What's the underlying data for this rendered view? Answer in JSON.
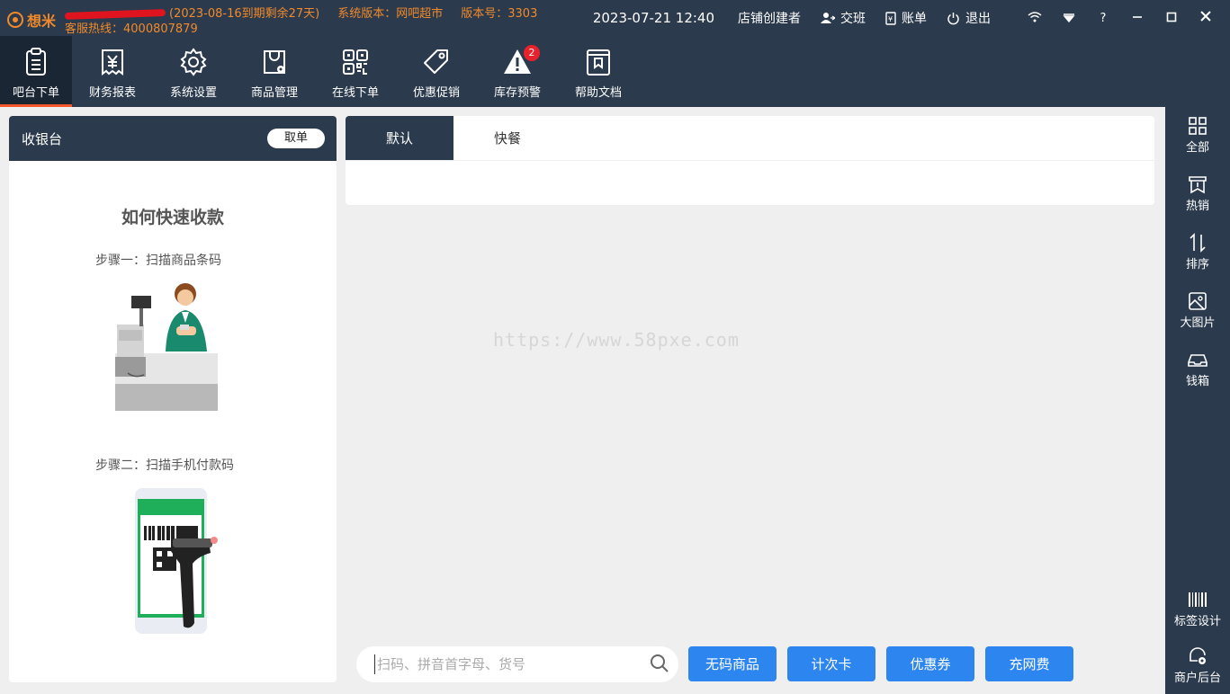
{
  "titlebar": {
    "logo_text": "想米",
    "expiry": "(2023-08-16到期剩余27天)",
    "system_version": "系统版本：网吧超市",
    "version_number": "版本号：3303",
    "hotline": "客服热线：4000807879",
    "datetime": "2023-07-21 12:40",
    "user": "店铺创建者",
    "shift": "交班",
    "bill": "账单",
    "logout": "退出",
    "help": "?"
  },
  "mainnav": [
    {
      "label": "吧台下单",
      "icon": "clipboard-icon"
    },
    {
      "label": "财务报表",
      "icon": "yen-receipt-icon"
    },
    {
      "label": "系统设置",
      "icon": "gear-icon"
    },
    {
      "label": "商品管理",
      "icon": "bag-gear-icon"
    },
    {
      "label": "在线下单",
      "icon": "qrcode-icon"
    },
    {
      "label": "优惠促销",
      "icon": "tag-icon"
    },
    {
      "label": "库存预警",
      "icon": "warning-icon",
      "badge": "2"
    },
    {
      "label": "帮助文档",
      "icon": "book-icon"
    }
  ],
  "cashier": {
    "title": "收银台",
    "cancel": "取单",
    "howto_title": "如何快速收款",
    "step1": "步骤一：扫描商品条码",
    "step2": "步骤二：扫描手机付款码"
  },
  "tabs": [
    "默认",
    "快餐"
  ],
  "watermark": "https://www.58pxe.com",
  "search": {
    "placeholder": "扫码、拼音首字母、货号"
  },
  "actions": [
    "无码商品",
    "计次卡",
    "优惠券",
    "充网费"
  ],
  "sidebar": [
    {
      "label": "全部",
      "icon": "grid-icon"
    },
    {
      "label": "热销",
      "icon": "hot-icon"
    },
    {
      "label": "排序",
      "icon": "sort-icon"
    },
    {
      "label": "大图片",
      "icon": "image-icon"
    },
    {
      "label": "钱箱",
      "icon": "cashbox-icon"
    },
    {
      "label": "标签设计",
      "icon": "barcode-icon"
    },
    {
      "label": "商户后台",
      "icon": "merchant-gear-icon"
    }
  ],
  "colors": {
    "primary": "#2b3a4d",
    "accent": "#f08a2a",
    "button": "#2d85f0",
    "badge": "#e8222c"
  }
}
